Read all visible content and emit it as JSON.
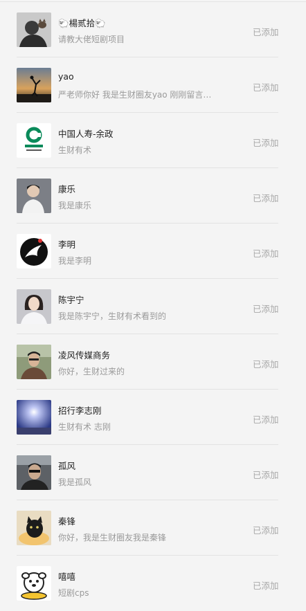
{
  "contacts": [
    {
      "name": "🐑楊贰拾🐑",
      "message": "请教大佬短剧项目",
      "status": "已添加",
      "avatar": "person-with-cat-avatar"
    },
    {
      "name": "yao",
      "message": "严老师你好 我是生财圈友yao 刚刚留言…",
      "status": "已添加",
      "avatar": "sunset-silhouette-avatar"
    },
    {
      "name": "中国人寿-余政",
      "message": "生财有术",
      "status": "已添加",
      "avatar": "china-life-logo-avatar"
    },
    {
      "name": "康乐",
      "message": "我是康乐",
      "status": "已添加",
      "avatar": "young-man-photo-avatar"
    },
    {
      "name": "李明",
      "message": "我是李明",
      "status": "已添加",
      "avatar": "black-bird-logo-avatar"
    },
    {
      "name": "陈宇宁",
      "message": "我是陈宇宁，生财有术看到的",
      "status": "已添加",
      "avatar": "woman-portrait-avatar"
    },
    {
      "name": "凌风传媒商务",
      "message": "你好，生财过来的",
      "status": "已添加",
      "avatar": "man-outdoor-avatar"
    },
    {
      "name": "招行李志刚",
      "message": "生财有术 志刚",
      "status": "已添加",
      "avatar": "night-light-avatar"
    },
    {
      "name": "孤风",
      "message": "我是孤风",
      "status": "已添加",
      "avatar": "man-in-car-avatar"
    },
    {
      "name": "秦锋",
      "message": "你好，我是生财圈友我是秦锋",
      "status": "已添加",
      "avatar": "black-cat-avatar"
    },
    {
      "name": "嘻嘻",
      "message": "短剧cps",
      "status": "已添加",
      "avatar": "cartoon-dog-avatar"
    }
  ]
}
